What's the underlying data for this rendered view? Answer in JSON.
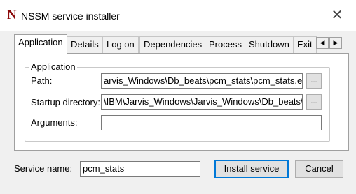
{
  "window": {
    "icon_glyph": "N",
    "title": "NSSM service installer",
    "close_glyph": "✕"
  },
  "tabs": [
    {
      "label": "Application",
      "active": true
    },
    {
      "label": "Details"
    },
    {
      "label": "Log on"
    },
    {
      "label": "Dependencies"
    },
    {
      "label": "Process"
    },
    {
      "label": "Shutdown"
    },
    {
      "label": "Exit"
    }
  ],
  "tab_scroll": {
    "left_glyph": "◀",
    "right_glyph": "▶"
  },
  "application": {
    "group_label": "Application",
    "path_label": "Path:",
    "path_value": "arvis_Windows\\Db_beats\\pcm_stats\\pcm_stats.exe",
    "startup_label": "Startup directory:",
    "startup_value": "\\IBM\\Jarvis_Windows\\Jarvis_Windows\\Db_beats\\",
    "arguments_label": "Arguments:",
    "arguments_value": "",
    "browse_label": "..."
  },
  "footer": {
    "service_name_label": "Service name:",
    "service_name_value": "pcm_stats",
    "install_label": "Install service",
    "cancel_label": "Cancel"
  }
}
